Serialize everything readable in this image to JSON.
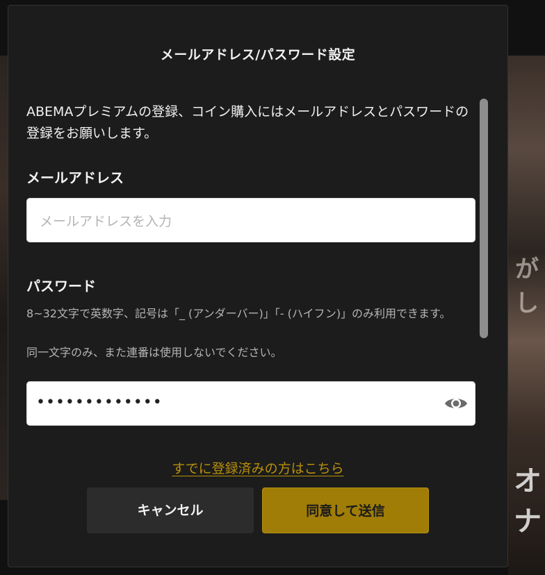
{
  "dialog": {
    "title": "メールアドレス/パスワード設定",
    "intro": "ABEMAプレミアムの登録、コイン購入にはメールアドレスとパスワードの登録をお願いします。",
    "email": {
      "label": "メールアドレス",
      "placeholder": "メールアドレスを入力",
      "value": ""
    },
    "password": {
      "label": "パスワード",
      "hint_line1": "8~32文字で英数字、記号は「_ (アンダーバー)」「- (ハイフン)」のみ利用できます。",
      "hint_line2": "同一文字のみ、また連番は使用しないでください。",
      "masked_value": "•••••••••••••",
      "toggle_icon": "eye-icon"
    },
    "existing_account_link": "すでに登録済みの方はこちら",
    "buttons": {
      "cancel": "キャンセル",
      "submit": "同意して送信"
    },
    "colors": {
      "accent": "#a07d06",
      "link": "#b8900a",
      "dialog_bg": "#1c1c1c"
    }
  },
  "background": {
    "partial_text_right_1": "がし",
    "partial_text_right_2": "オナ"
  }
}
